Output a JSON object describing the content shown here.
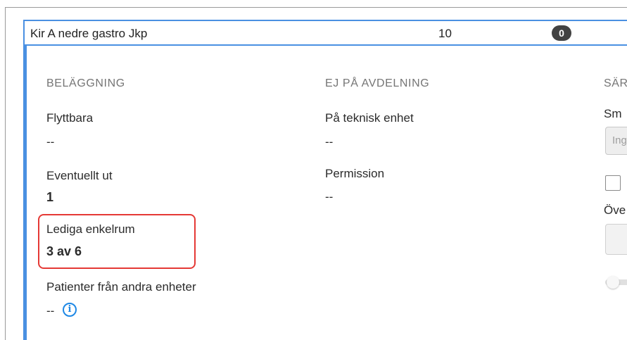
{
  "unit": {
    "name": "Kir A nedre gastro Jkp",
    "count": "10",
    "badge": "0"
  },
  "columns": {
    "belaggning": {
      "heading": "BELÄGGNING",
      "fields": [
        {
          "label": "Flyttbara",
          "value": "--"
        },
        {
          "label": "Eventuellt ut",
          "value": "1"
        },
        {
          "label": "Lediga enkelrum",
          "value": "3 av 6"
        },
        {
          "label": "Patienter från andra enheter",
          "value": "--"
        }
      ]
    },
    "ej_pa_avdelning": {
      "heading": "EJ PÅ AVDELNING",
      "fields": [
        {
          "label": "På teknisk enhet",
          "value": "--"
        },
        {
          "label": "Permission",
          "value": "--"
        }
      ]
    },
    "third": {
      "heading": "SÄR",
      "label_sm": "Sm",
      "input_placeholder": "Ing",
      "label_ove": "Öve"
    }
  },
  "icons": {
    "info": "info-icon"
  },
  "colors": {
    "accent": "#4a90e2",
    "highlight": "#e53935",
    "info": "#1e88e5",
    "badge": "#424242"
  }
}
